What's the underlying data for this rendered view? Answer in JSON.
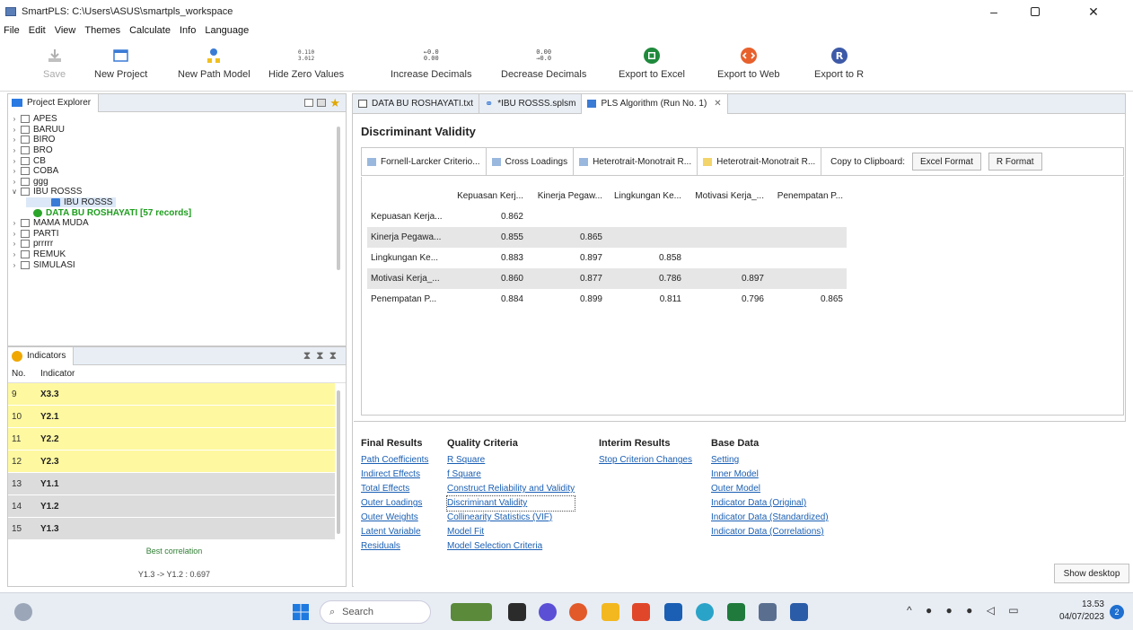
{
  "window": {
    "title": "SmartPLS: C:\\Users\\ASUS\\smartpls_workspace",
    "minimize": "–",
    "maximize": "□",
    "close": "✕"
  },
  "menu": [
    "File",
    "Edit",
    "View",
    "Themes",
    "Calculate",
    "Info",
    "Language"
  ],
  "toolbar": {
    "save": "Save",
    "new_project": "New Project",
    "new_path_model": "New Path Model",
    "hide_zero_values": "Hide Zero Values",
    "hide_zero_icon_text": "0.110\n3.012",
    "increase_decimals": "Increase Decimals",
    "decrease_decimals": "Decrease Decimals",
    "export_excel": "Export to Excel",
    "export_web": "Export to Web",
    "export_r": "Export to R"
  },
  "project_explorer": {
    "title": "Project Explorer",
    "items": [
      {
        "label": "APES",
        "level": 0,
        "expanded": false
      },
      {
        "label": "BARUU",
        "level": 0,
        "expanded": false
      },
      {
        "label": "BIRO",
        "level": 0,
        "expanded": false
      },
      {
        "label": "BRO",
        "level": 0,
        "expanded": false
      },
      {
        "label": "CB",
        "level": 0,
        "expanded": false
      },
      {
        "label": "COBA",
        "level": 0,
        "expanded": false
      },
      {
        "label": "ggg",
        "level": 0,
        "expanded": false
      },
      {
        "label": "IBU ROSSS",
        "level": 0,
        "expanded": true
      },
      {
        "label": "IBU ROSSS",
        "level": 1,
        "type": "model"
      },
      {
        "label": "DATA BU ROSHAYATI [57 records]",
        "level": 1,
        "type": "data"
      },
      {
        "label": "MAMA MUDA",
        "level": 0,
        "expanded": false
      },
      {
        "label": "PARTI",
        "level": 0,
        "expanded": false
      },
      {
        "label": "prrrrr",
        "level": 0,
        "expanded": false
      },
      {
        "label": "REMUK",
        "level": 0,
        "expanded": false
      },
      {
        "label": "SIMULASI",
        "level": 0,
        "expanded": false
      }
    ]
  },
  "indicators": {
    "title": "Indicators",
    "col_no": "No.",
    "col_indicator": "Indicator",
    "rows": [
      {
        "no": "9",
        "name": "X3.3",
        "color": "#fef8a0"
      },
      {
        "no": "10",
        "name": "Y2.1",
        "color": "#fef8a0"
      },
      {
        "no": "11",
        "name": "Y2.2",
        "color": "#fef8a0"
      },
      {
        "no": "12",
        "name": "Y2.3",
        "color": "#fef8a0"
      },
      {
        "no": "13",
        "name": "Y1.1",
        "color": "#dcdcdc"
      },
      {
        "no": "14",
        "name": "Y1.2",
        "color": "#dcdcdc"
      },
      {
        "no": "15",
        "name": "Y1.3",
        "color": "#dcdcdc"
      }
    ],
    "best_correlation_label": "Best correlation",
    "best_correlation_value": "Y1.3 -> Y1.2 : 0.697"
  },
  "editor_tabs": [
    {
      "label": "DATA BU ROSHAYATI.txt"
    },
    {
      "label": "*IBU ROSSS.splsm"
    },
    {
      "label": "PLS Algorithm (Run No. 1)",
      "active": true
    }
  ],
  "section_title": "Discriminant Validity",
  "subtabs": [
    {
      "label": "Fornell-Larcker Criterio..."
    },
    {
      "label": "Cross Loadings"
    },
    {
      "label": "Heterotrait-Monotrait R..."
    },
    {
      "label": "Heterotrait-Monotrait R..."
    }
  ],
  "clipboard": {
    "label": "Copy to Clipboard:",
    "excel": "Excel Format",
    "r": "R Format"
  },
  "table": {
    "headers": [
      "Kepuasan Kerj...",
      "Kinerja Pegaw...",
      "Lingkungan Ke...",
      "Motivasi Kerja_...",
      "Penempatan P..."
    ],
    "rows": [
      {
        "label": "Kepuasan Kerja...",
        "values": [
          "0.862",
          "",
          "",
          "",
          ""
        ]
      },
      {
        "label": "Kinerja Pegawa...",
        "values": [
          "0.855",
          "0.865",
          "",
          "",
          ""
        ]
      },
      {
        "label": "Lingkungan Ke...",
        "values": [
          "0.883",
          "0.897",
          "0.858",
          "",
          ""
        ]
      },
      {
        "label": "Motivasi Kerja_...",
        "values": [
          "0.860",
          "0.877",
          "0.786",
          "0.897",
          ""
        ]
      },
      {
        "label": "Penempatan P...",
        "values": [
          "0.884",
          "0.899",
          "0.811",
          "0.796",
          "0.865"
        ]
      }
    ]
  },
  "results": {
    "final": {
      "title": "Final Results",
      "links": [
        "Path Coefficients",
        "Indirect Effects",
        "Total Effects",
        "Outer Loadings",
        "Outer Weights",
        "Latent Variable",
        "Residuals"
      ]
    },
    "quality": {
      "title": "Quality Criteria",
      "links": [
        "R Square",
        "f Square",
        "Construct Reliability and Validity",
        "Discriminant Validity",
        "Collinearity Statistics (VIF)",
        "Model Fit",
        "Model Selection Criteria"
      ]
    },
    "interim": {
      "title": "Interim Results",
      "links": [
        "Stop Criterion Changes"
      ]
    },
    "base": {
      "title": "Base Data",
      "links": [
        "Setting",
        "Inner Model",
        "Outer Model",
        "Indicator Data (Original)",
        "Indicator Data (Standardized)",
        "Indicator Data (Correlations)"
      ]
    }
  },
  "show_desktop": "Show desktop",
  "taskbar": {
    "search_placeholder": "Search",
    "time": "13.53",
    "date": "04/07/2023",
    "notif_count": "2"
  }
}
